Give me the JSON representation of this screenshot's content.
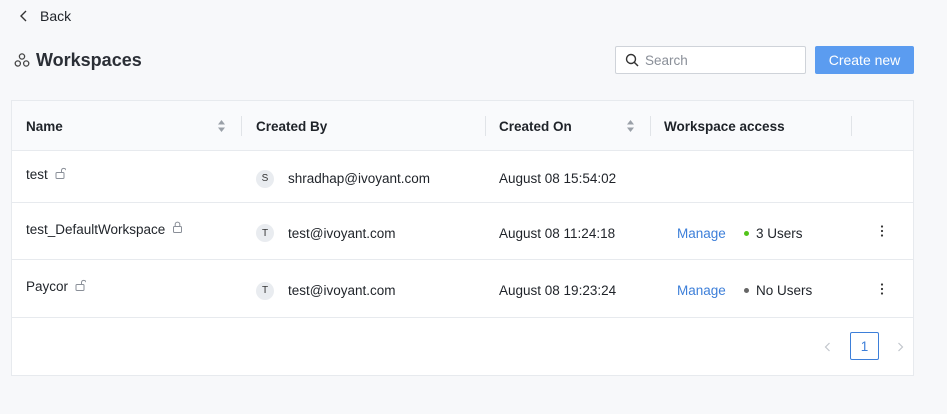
{
  "back_label": "Back",
  "page_title": "Workspaces",
  "search": {
    "placeholder": "Search",
    "value": ""
  },
  "create_button": "Create new",
  "table": {
    "columns": [
      "Name",
      "Created By",
      "Created On",
      "Workspace access"
    ],
    "rows": [
      {
        "name": "test",
        "avatar": "S",
        "created_by": "shradhap@ivoyant.com",
        "created_on": "August 08 15:54:02",
        "manage": "",
        "users": "",
        "status_color": ""
      },
      {
        "name": "test_DefaultWorkspace",
        "avatar": "T",
        "created_by": "test@ivoyant.com",
        "created_on": "August 08 11:24:18",
        "manage": "Manage",
        "users": "3 Users",
        "status_color": "#52c41a"
      },
      {
        "name": "Paycor",
        "avatar": "T",
        "created_by": "test@ivoyant.com",
        "created_on": "August 08 19:23:24",
        "manage": "Manage",
        "users": "No Users",
        "status_color": "#666666"
      }
    ]
  },
  "pagination": {
    "current_page": "1"
  },
  "colors": {
    "accent": "#5b9cf0",
    "link": "#3d7fd9"
  },
  "icons": [
    "chevron-left-icon",
    "workspaces-icon",
    "search-icon",
    "sort-icon",
    "lock-open-icon",
    "lock-icon",
    "more-vertical-icon",
    "chevron-right-icon"
  ]
}
